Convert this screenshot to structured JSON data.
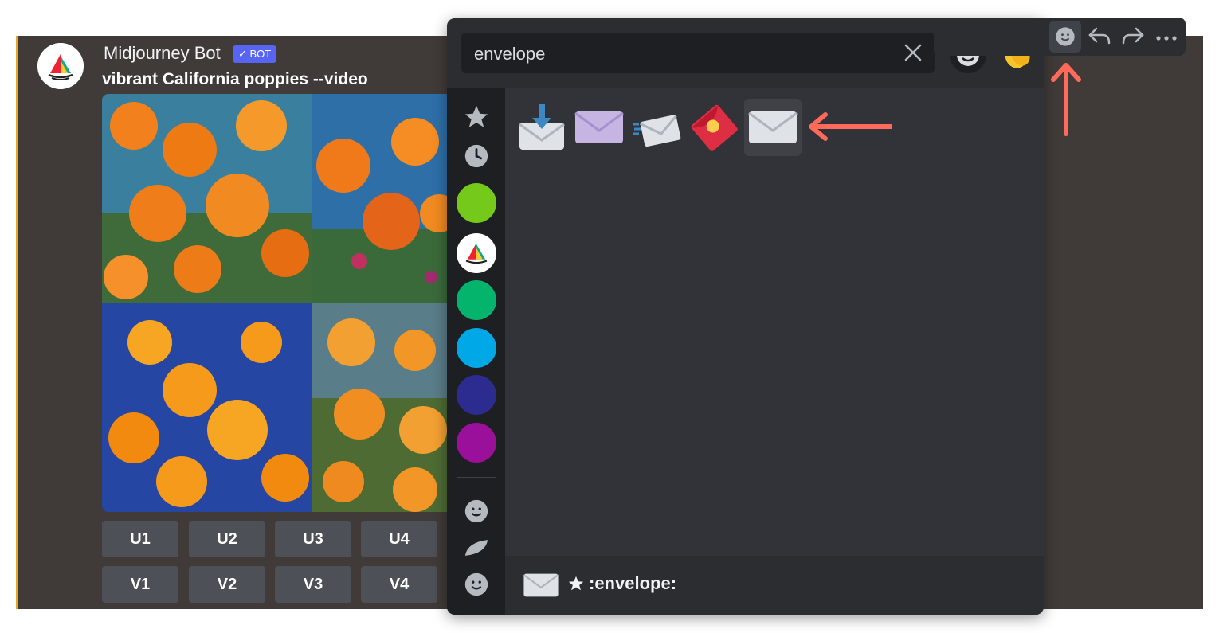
{
  "message": {
    "author": "Midjourney Bot",
    "badge": "BOT",
    "prompt": "vibrant California poppies --video",
    "buttons_upscale": [
      "U1",
      "U2",
      "U3",
      "U4"
    ],
    "buttons_variation": [
      "V1",
      "V2",
      "V3",
      "V4"
    ]
  },
  "picker": {
    "search_value": "envelope",
    "preview_label": ":envelope:",
    "results": [
      "incoming-envelope-icon",
      "envelope-purple-icon",
      "flying-envelope-icon",
      "red-envelope-icon",
      "envelope-icon"
    ],
    "sidebar_colors": [
      "#74c91a",
      "#04b46c",
      "#00a8e8",
      "#2c2b8f",
      "#9b109a"
    ]
  },
  "colors": {
    "accent_arrow": "#ff6a5a",
    "bot_badge": "#5865f2",
    "left_border": "#e8a52a"
  }
}
